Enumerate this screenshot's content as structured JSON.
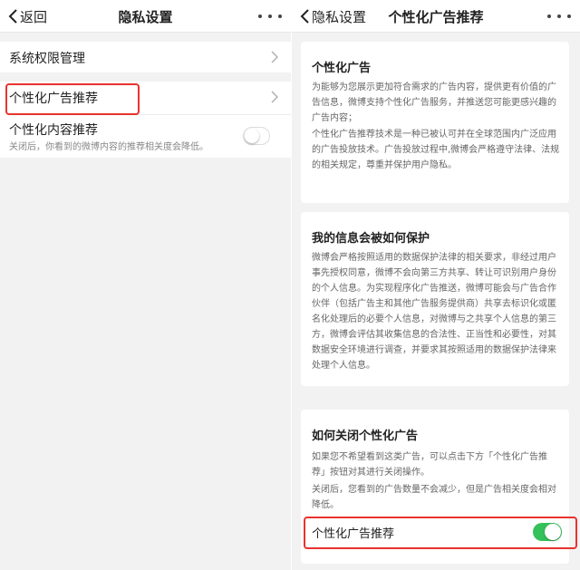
{
  "left": {
    "navbar": {
      "back_label": "返回",
      "title": "隐私设置"
    },
    "rows": [
      {
        "label": "系统权限管理"
      },
      {
        "label": "个性化广告推荐"
      },
      {
        "label": "个性化内容推荐",
        "sub": "关闭后，你看到的微博内容的推荐相关度会降低。",
        "toggle_on": false
      }
    ]
  },
  "right": {
    "navbar": {
      "back_label": "隐私设置",
      "title": "个性化广告推荐"
    },
    "cards": [
      {
        "title": "个性化广告",
        "paragraphs": [
          "为能够为您展示更加符合需求的广告内容，提供更有价值的广告信息，微博支持个性化广告服务，并推送您可能更感兴趣的广告内容；",
          "个性化广告推荐技术是一种已被认可并在全球范围内广泛应用的广告投放技术。广告投放过程中,微博会严格遵守法律、法规的相关规定，尊重并保护用户隐私。"
        ]
      },
      {
        "title": "我的信息会被如何保护",
        "paragraphs": [
          "微博会严格按照适用的数据保护法律的相关要求，非经过用户事先授权同意，微博不会向第三方共享、转让可识别用户身份的个人信息。为实现程序化广告推送，微博可能会与广告合作伙伴（包括广告主和其他广告服务提供商）共享去标识化或匿名化处理后的必要个人信息，对微博与之共享个人信息的第三方，微博会评估其收集信息的合法性、正当性和必要性，对其数据安全环境进行调查，并要求其按照适用的数据保护法律来处理个人信息。"
        ]
      },
      {
        "title": "如何关闭个性化广告",
        "paragraphs": [
          "如果您不希望看到这类广告，可以点击下方「个性化广告推荐」按钮对其进行关闭操作。",
          "关闭后，您看到的广告数量不会减少，但是广告相关度会相对降低。"
        ],
        "toggle_label": "个性化广告推荐",
        "toggle_on": true
      }
    ]
  },
  "colors": {
    "highlight": "#e8332f",
    "toggle_on": "#35c15a",
    "background": "#f2f2f2"
  },
  "icons": {
    "back": "chevron-left-icon",
    "more": "more-dots-icon",
    "row": "chevron-right-icon"
  }
}
